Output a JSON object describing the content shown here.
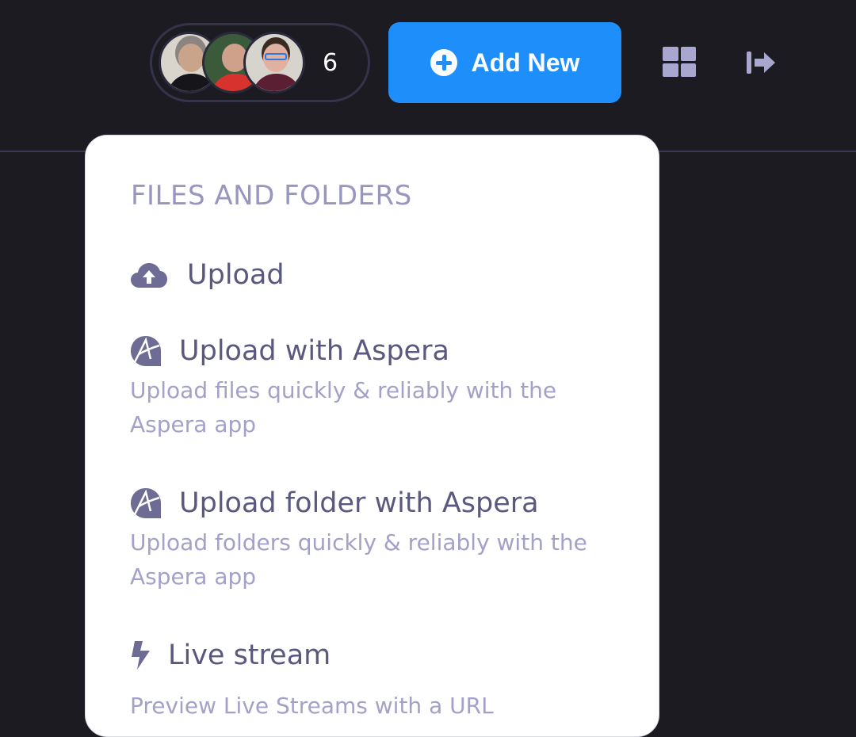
{
  "header": {
    "collaborators": {
      "avatars": [
        {
          "name": "avatar-woman-gray-hair"
        },
        {
          "name": "avatar-man-red-shirt"
        },
        {
          "name": "avatar-person-blue-glasses"
        }
      ],
      "count": "6"
    },
    "add_new_button": {
      "label": "Add New",
      "icon": "plus-circle-icon"
    },
    "grid_icon": "grid-view-icon",
    "exit_icon": "sign-out-icon"
  },
  "dropdown": {
    "section_title": "FILES AND FOLDERS",
    "items": [
      {
        "label": "Upload",
        "icon": "cloud-upload-icon",
        "description": ""
      },
      {
        "label": "Upload with Aspera",
        "icon": "aspera-icon",
        "description": "Upload files quickly & reliably with the Aspera app"
      },
      {
        "label": "Upload folder with Aspera",
        "icon": "aspera-icon",
        "description": "Upload folders quickly & reliably with the Aspera app"
      },
      {
        "label": "Live stream",
        "icon": "lightning-bolt-icon",
        "description": "Preview Live Streams with a URL"
      }
    ]
  },
  "colors": {
    "background": "#1c1b22",
    "accent": "#1e8ffa",
    "icon_muted": "#a9a7d0",
    "menu_text": "#5a587e",
    "menu_desc": "#a3a1c8",
    "section_title": "#9896c0"
  }
}
